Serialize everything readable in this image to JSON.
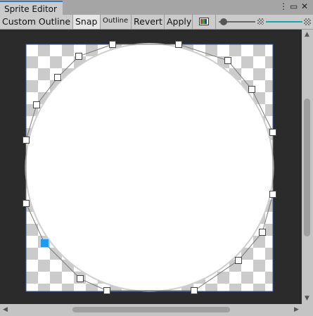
{
  "tab": {
    "title": "Sprite Editor"
  },
  "toolbar": {
    "mode_label": "Custom Outline",
    "snap_label": "Snap",
    "outline_label": "Outline",
    "revert_label": "Revert",
    "apply_label": "Apply",
    "color_toggle_icon": "rgb-channels-icon",
    "zoom_level": 0.08,
    "mip_level": 1.0
  },
  "colors": {
    "accent": "#3a79bb",
    "selected_vertex": "#1e9bf0",
    "viewport_bg": "#2b2b2b"
  },
  "outline_vertices_count": 18
}
